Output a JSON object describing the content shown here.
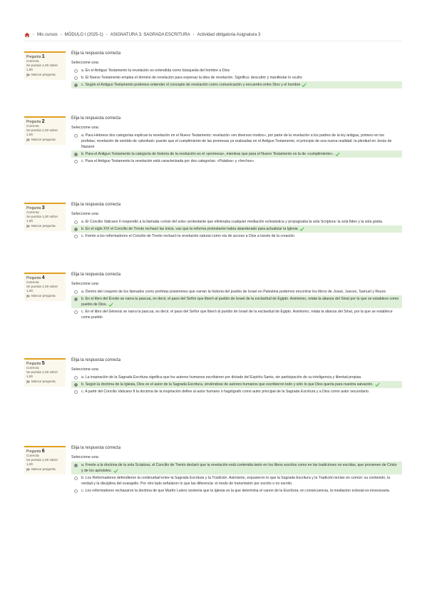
{
  "breadcrumb": {
    "items": [
      "Mis cursos",
      "MÓDULO I (2025-1)",
      "ASIGNATURA 3. SAGRADA ESCRITURA",
      "Actividad obligatoria Asignatura 3"
    ]
  },
  "common": {
    "prompt": "Elija la respuesta correcta",
    "select_one": "Seleccione una:",
    "status": "Correcta",
    "score": "Se puntúa 1,00 sobre 1,00",
    "flag": "Marcar pregunta",
    "question_word": "Pregunta"
  },
  "questions": [
    {
      "number": "1",
      "answers": [
        {
          "text": "a. En el Antiguo Testamento la revelación es entendida como búsqueda del hombre a Dios",
          "correct": false
        },
        {
          "text": "b. El Nuevo Testamento emplea el término de revelación para expresar la idea de revelación. Significa: descubrir y manifestar lo oculto",
          "correct": false
        },
        {
          "text": "c. Según el Antiguo Testamento podemos entender el concepto de revelación como comunicación y encuentro entre Dios y el hombre",
          "correct": true
        }
      ]
    },
    {
      "number": "2",
      "answers": [
        {
          "text": "a. Para Hebreos dos categorías explican la revelación en el Nuevo Testamento: revelación «en diversos modos», por parte de la revelación a los padres de la ley antigua, primero en los profetas; revelación de sentido de «plenitud» puesto que el cumplimiento de las promesas ya realizadas en el Antiguo Testamento, el principio de una nueva realidad: la plenitud en Jesús de Nazaret",
          "correct": false
        },
        {
          "text": "b. Para el Antiguo Testamento la categoría de historia de la revelación es el «promesa», mientras que para el Nuevo Testamento es la de «cumplimiento».",
          "correct": true
        },
        {
          "text": "c. Para el Antiguo Testamento la revelación está caracterizada por dos categorías: «Palabra» y «hechos».",
          "correct": false
        }
      ]
    },
    {
      "number": "3",
      "answers": [
        {
          "text": "a. El Concilio Vaticano II respondió a la llamada «crisis del sola» protestante que eliminaba cualquier mediación eclesiástica y propugnaba la sola Scriptura: la sola fides y la sola gratia.",
          "correct": false
        },
        {
          "text": "b. En el siglo XVI el Concilio de Trento rechazó las inicia. vas que la reforma protestante había abanderado para actualizar la Iglesia",
          "correct": true
        },
        {
          "text": "c. Frente a los reformadores el Concilio de Trento rechazó la revelación natural como vía de acceso a Dios a través de la creación",
          "correct": false
        }
      ]
    },
    {
      "number": "4",
      "answers": [
        {
          "text": "a. Dentro del conjunto de los llamados como profetas posteriores que narran la historia del pueblo de Israel en Palestina podemos encontrar los libros de Josué, Jueces, Samuel y Reyes",
          "correct": false
        },
        {
          "text": "b. En el libro del Éxodo se narra la pascua, es decir, el paso del Señor que liberó al pueblo de Israel de la esclavitud de Egipto. Asimismo, relata la alianza del Sinaí por la que se establece como pueblo de Dios.",
          "correct": true
        },
        {
          "text": "c. En el libro del Génesis se narra la pascua, es decir, el paso del Señor que liberó al pueblo de Israel de la esclavitud de Egipto. Asimismo, relata la alianza del Sinaí, por la que se establece como pueblo",
          "correct": false
        }
      ]
    },
    {
      "number": "5",
      "answers": [
        {
          "text": "a. La inspiración de la Sagrada Escritura significa que los autores humanos escribieron por dictado del Espíritu Santo, sin participación de su inteligencia y libertad propias.",
          "correct": false
        },
        {
          "text": "b. Según la doctrina de la Iglesia, Dios es el autor de la Sagrada Escritura, sirviéndose de autores humanos que escribieron todo y sólo lo que Dios quería para nuestra salvación.",
          "correct": true
        },
        {
          "text": "c. A partir del Concilio Vaticano II la doctrina de la inspiración define al autor humano o hagiógrafo como autor principal de la Sagrada Escritura y a Dios como autor secundario.",
          "correct": false
        }
      ]
    },
    {
      "number": "6",
      "answers": [
        {
          "text": "a. Frente a la doctrina de la sola Scriptura, el Concilio de Trento declaró que la revelación está contenida tanto en los libros escritos como en las tradiciones no escritas, que provienen de Cristo y de los apóstoles.",
          "correct": true
        },
        {
          "text": "b. Los Reformadores defendieron la continuidad entre la Sagrada Escritura y la Tradición. Asimismo, expusieron lo que la Sagrada Escritura y la Tradición tenían en común: su contenido, la verdad y la disciplina del evangelio. Por otro lado señalaron lo que las diferencia: el modo de transmisión por escrito o no escrito.",
          "correct": false
        },
        {
          "text": "c. Los reformadores rechazaron la doctrina de que Martín Lutero sostenía que la Iglesia es la que determina el canon de la Escritura; en consecuencia, la mediación eclesial es innecesaria.",
          "correct": false
        }
      ]
    }
  ]
}
